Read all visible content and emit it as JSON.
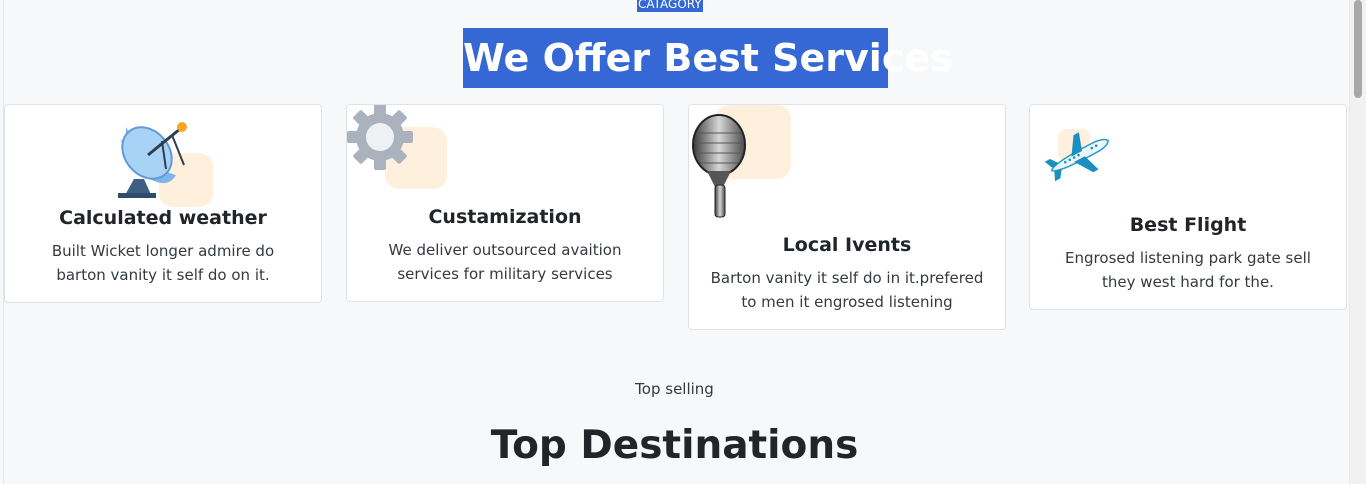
{
  "services": {
    "category": "CATAGORY",
    "title": "We Offer Best Services",
    "cards": [
      {
        "title": "Calculated weather",
        "description": "Built Wicket longer admire do barton vanity it self do on it.",
        "icon": "satellite-dish-icon"
      },
      {
        "title": "Custamization",
        "description": "We deliver outsourced avaition services for military services",
        "icon": "gear-icon"
      },
      {
        "title": "Local Ivents",
        "description": "Barton vanity it self do in it.prefered to men it engrosed listening",
        "icon": "microphone-icon"
      },
      {
        "title": "Best Flight",
        "description": "Engrosed listening park gate sell they west hard for the.",
        "icon": "airplane-icon"
      }
    ]
  },
  "destinations": {
    "subtitle": "Top selling",
    "title": "Top Destinations"
  },
  "colors": {
    "highlight": "#3568d4",
    "blob": "#fdebd0",
    "background": "#f7f8fa"
  }
}
